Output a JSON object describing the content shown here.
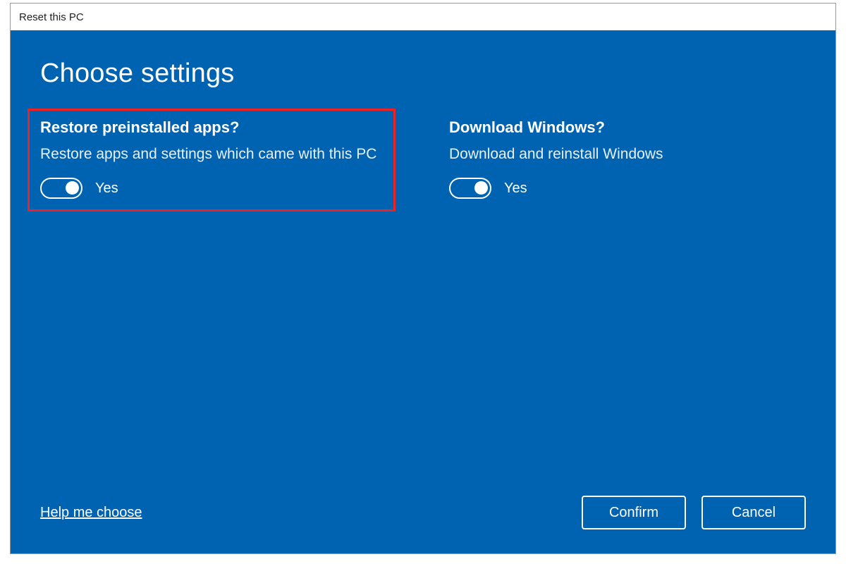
{
  "titlebar": {
    "title": "Reset this PC"
  },
  "page": {
    "heading": "Choose settings"
  },
  "settings": {
    "restore": {
      "title": "Restore preinstalled apps?",
      "description": "Restore apps and settings which came with this PC",
      "value_label": "Yes",
      "highlighted": true
    },
    "download": {
      "title": "Download Windows?",
      "description": "Download and reinstall Windows",
      "value_label": "Yes"
    }
  },
  "footer": {
    "help_link": "Help me choose",
    "confirm_label": "Confirm",
    "cancel_label": "Cancel"
  }
}
